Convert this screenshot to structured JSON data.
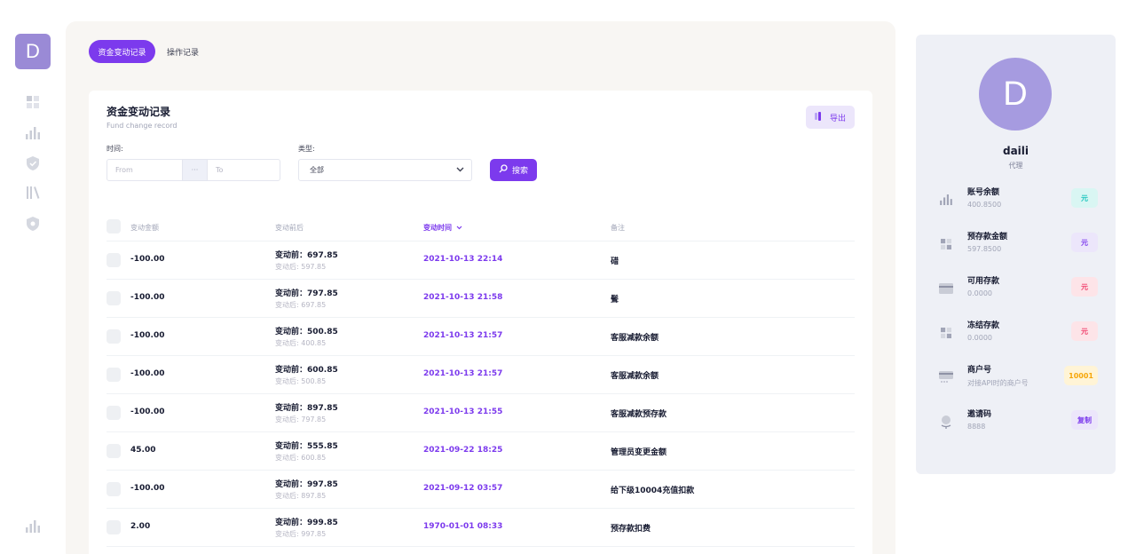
{
  "rail": {
    "avatar_letter": "D",
    "icons": [
      "dashboard-icon",
      "chart-icon",
      "shield-icon",
      "library-icon",
      "badge-icon"
    ],
    "bottom_icon": "chart-icon"
  },
  "tabs": [
    {
      "label": "资金变动记录",
      "active": true
    },
    {
      "label": "操作记录",
      "active": false
    }
  ],
  "card": {
    "title": "资金变动记录",
    "subtitle": "Fund change record",
    "export_label": "导出"
  },
  "filters": {
    "time_label": "时间:",
    "from_placeholder": "From",
    "range_separator": "···",
    "to_placeholder": "To",
    "type_label": "类型:",
    "type_selected": "全部",
    "search_label": "搜索"
  },
  "table": {
    "columns": [
      "变动金额",
      "变动前后",
      "变动时间",
      "备注"
    ],
    "sorted_column": "变动时间",
    "rows": [
      {
        "amount": "-100.00",
        "before": "变动前：697.85",
        "after": "变动后: 597.85",
        "time": "2021-10-13 22:14:2{",
        "note": "碏"
      },
      {
        "amount": "-100.00",
        "before": "变动前：797.85",
        "after": "变动后: 697.85",
        "time": "2021-10-13 21:58:56",
        "note": "髶"
      },
      {
        "amount": "-100.00",
        "before": "变动前：500.85",
        "after": "变动后: 400.85",
        "time": "2021-10-13 21:57:44",
        "note": "客服减款余额"
      },
      {
        "amount": "-100.00",
        "before": "变动前：600.85",
        "after": "变动后: 500.85",
        "time": "2021-10-13 21:57:18",
        "note": "客服减款余额"
      },
      {
        "amount": "-100.00",
        "before": "变动前：897.85",
        "after": "变动后: 797.85",
        "time": "2021-10-13 21:55:29",
        "note": "客服减款预存款"
      },
      {
        "amount": "45.00",
        "before": "变动前：555.85",
        "after": "变动后: 600.85",
        "time": "2021-09-22 18:25:21",
        "note": "管理员变更金额"
      },
      {
        "amount": "-100.00",
        "before": "变动前：997.85",
        "after": "变动后: 897.85",
        "time": "2021-09-12 03:57:03",
        "note": "给下级10004充值扣款"
      },
      {
        "amount": "2.00",
        "before": "变动前：999.85",
        "after": "变动后: 997.85",
        "time": "1970-01-01 08:33:41",
        "note": "预存款扣费"
      }
    ]
  },
  "profile": {
    "avatar_letter": "D",
    "name": "daili",
    "role": "代理",
    "stats": [
      {
        "label": "账号余额",
        "value": "400.8500",
        "badge": "元",
        "icon": "chart-icon",
        "badge_bg": "#d9f6f3",
        "badge_fg": "#1bc5bd"
      },
      {
        "label": "预存款金额",
        "value": "597.8500",
        "badge": "元",
        "icon": "dashboard-icon",
        "badge_bg": "#ece6fb",
        "badge_fg": "#7c3aed"
      },
      {
        "label": "可用存款",
        "value": "0.0000",
        "badge": "元",
        "icon": "card-icon",
        "badge_bg": "#fde4e8",
        "badge_fg": "#f1416c"
      },
      {
        "label": "冻结存款",
        "value": "0.0000",
        "badge": "元",
        "icon": "dashboard-icon",
        "badge_bg": "#fde4e8",
        "badge_fg": "#f1416c"
      },
      {
        "label": "商户号",
        "value": "对接API时的商户号",
        "badge": "10001",
        "icon": "merchant-icon",
        "badge_bg": "#fff4d6",
        "badge_fg": "#f6a609"
      },
      {
        "label": "邀请码",
        "value": "8888",
        "badge": "复制",
        "icon": "globe-icon",
        "badge_bg": "#ece6fb",
        "badge_fg": "#7c3aed"
      }
    ]
  }
}
